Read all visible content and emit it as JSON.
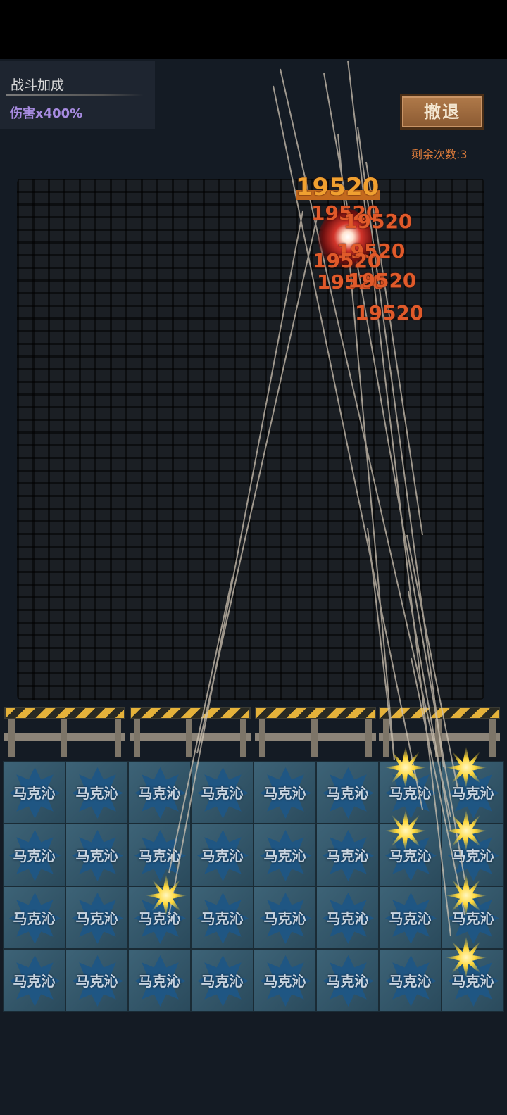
{
  "bonus": {
    "title": "战斗加成",
    "value": "伤害x400%"
  },
  "retreat_label": "撤退",
  "remaining_text": "剩余次数:3",
  "hero_label": "马克沁",
  "grid": {
    "rows": 4,
    "cols": 8
  },
  "damage_numbers": [
    "19520",
    "19520",
    "19520",
    "19520",
    "19520",
    "19520",
    "19520",
    "19520"
  ],
  "colors": {
    "damage": "#e05a2a",
    "bonus": "#a78be0",
    "retreat_bg": "#9a6a3e",
    "tile": "#1f5683"
  }
}
